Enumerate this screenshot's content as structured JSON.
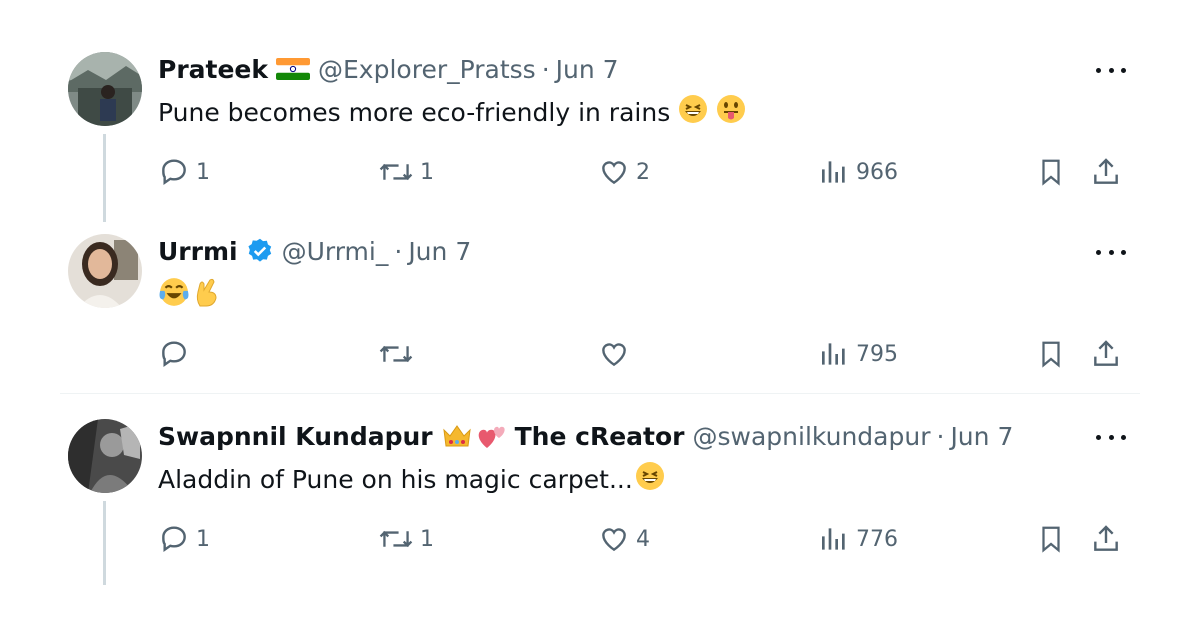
{
  "tweets": [
    {
      "name": "Prateek",
      "handle": "@Explorer_Pratss",
      "dot": "·",
      "date": "Jun 7",
      "text": "Pune becomes more eco-friendly in rains",
      "emojis": [
        "grinning-squinting",
        "tongue-out"
      ],
      "badge": "india-flag",
      "replies": "1",
      "reposts": "1",
      "likes": "2",
      "views": "966"
    },
    {
      "name": "Urrmi",
      "handle": "@Urrmi_",
      "dot": "·",
      "date": "Jun 7",
      "text": "",
      "emojis": [
        "tears-of-joy",
        "crossed-fingers"
      ],
      "badge": "verified-check",
      "replies": "",
      "reposts": "",
      "likes": "",
      "views": "795"
    },
    {
      "name": "Swapnnil Kundapur",
      "name_suffix": "The cReator",
      "handle": "@swapnilkundapur",
      "dot": "·",
      "date": "Jun 7",
      "text": "Aladdin of Pune on his magic carpet...",
      "emojis": [
        "grinning-squinting"
      ],
      "badge": "crown-and-hearts",
      "replies": "1",
      "reposts": "1",
      "likes": "4",
      "views": "776"
    }
  ],
  "colors": {
    "text": "#0f1419",
    "muted": "#536471",
    "verified": "#1d9bf0",
    "thread_line": "#cfd9de"
  }
}
